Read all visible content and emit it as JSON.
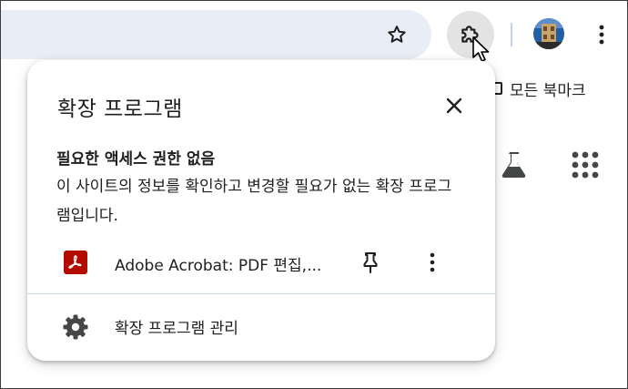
{
  "colors": {
    "omnibox_bg": "#e9eef6",
    "extension_button_bg": "#e3e3e3",
    "acrobat_red": "#b30b00",
    "divider": "#c7d7ee",
    "icon_gray": "#444746"
  },
  "toolbar": {
    "icons": [
      "star-icon",
      "puzzle-icon",
      "avatar",
      "kebab-menu-icon"
    ]
  },
  "bookmarks": {
    "all_bookmarks_label": "모든 북마크"
  },
  "popup": {
    "title": "확장 프로그램",
    "section_title": "필요한 액세스 권한 없음",
    "section_desc": "이 사이트의 정보를 확인하고 변경할 필요가 없는 확장 프로그램입니다.",
    "extensions": [
      {
        "name": "Adobe Acrobat: PDF 편집,...",
        "icon": "adobe-acrobat-icon"
      }
    ],
    "manage_label": "확장 프로그램 관리"
  }
}
